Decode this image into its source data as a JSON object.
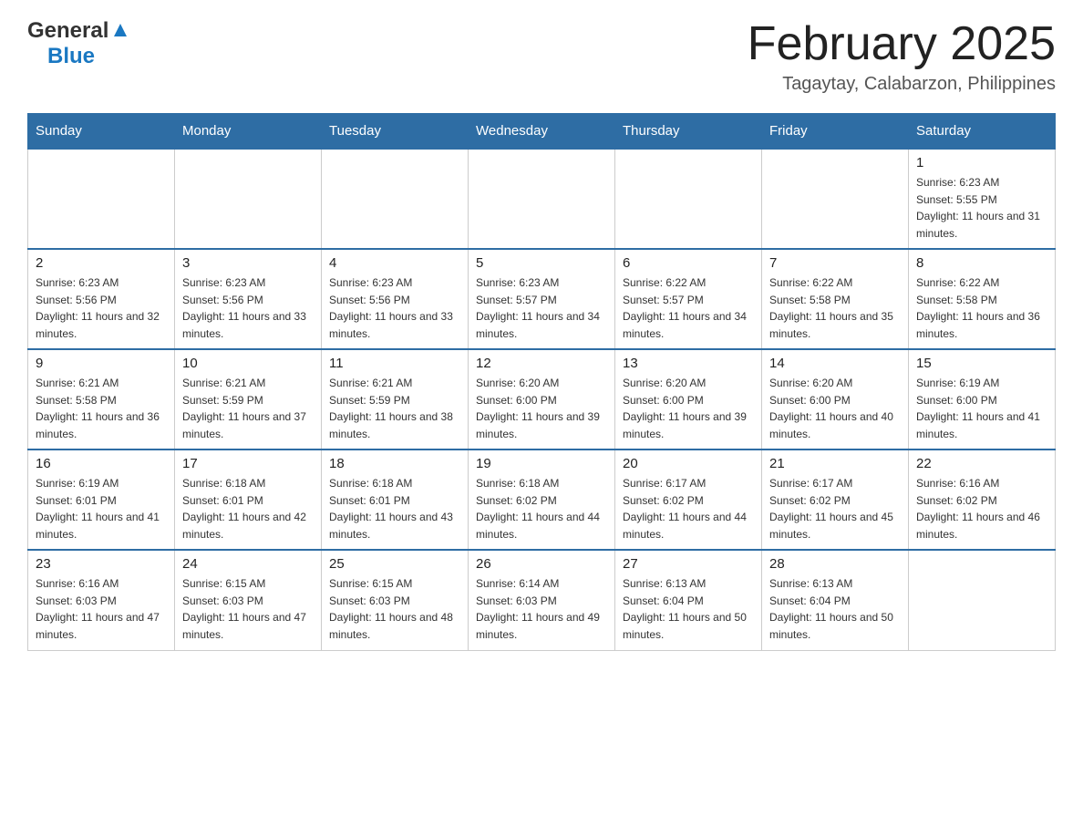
{
  "header": {
    "logo_general": "General",
    "logo_blue": "Blue",
    "month_title": "February 2025",
    "location": "Tagaytay, Calabarzon, Philippines"
  },
  "days_of_week": [
    "Sunday",
    "Monday",
    "Tuesday",
    "Wednesday",
    "Thursday",
    "Friday",
    "Saturday"
  ],
  "weeks": [
    [
      {
        "day": "",
        "info": ""
      },
      {
        "day": "",
        "info": ""
      },
      {
        "day": "",
        "info": ""
      },
      {
        "day": "",
        "info": ""
      },
      {
        "day": "",
        "info": ""
      },
      {
        "day": "",
        "info": ""
      },
      {
        "day": "1",
        "info": "Sunrise: 6:23 AM\nSunset: 5:55 PM\nDaylight: 11 hours and 31 minutes."
      }
    ],
    [
      {
        "day": "2",
        "info": "Sunrise: 6:23 AM\nSunset: 5:56 PM\nDaylight: 11 hours and 32 minutes."
      },
      {
        "day": "3",
        "info": "Sunrise: 6:23 AM\nSunset: 5:56 PM\nDaylight: 11 hours and 33 minutes."
      },
      {
        "day": "4",
        "info": "Sunrise: 6:23 AM\nSunset: 5:56 PM\nDaylight: 11 hours and 33 minutes."
      },
      {
        "day": "5",
        "info": "Sunrise: 6:23 AM\nSunset: 5:57 PM\nDaylight: 11 hours and 34 minutes."
      },
      {
        "day": "6",
        "info": "Sunrise: 6:22 AM\nSunset: 5:57 PM\nDaylight: 11 hours and 34 minutes."
      },
      {
        "day": "7",
        "info": "Sunrise: 6:22 AM\nSunset: 5:58 PM\nDaylight: 11 hours and 35 minutes."
      },
      {
        "day": "8",
        "info": "Sunrise: 6:22 AM\nSunset: 5:58 PM\nDaylight: 11 hours and 36 minutes."
      }
    ],
    [
      {
        "day": "9",
        "info": "Sunrise: 6:21 AM\nSunset: 5:58 PM\nDaylight: 11 hours and 36 minutes."
      },
      {
        "day": "10",
        "info": "Sunrise: 6:21 AM\nSunset: 5:59 PM\nDaylight: 11 hours and 37 minutes."
      },
      {
        "day": "11",
        "info": "Sunrise: 6:21 AM\nSunset: 5:59 PM\nDaylight: 11 hours and 38 minutes."
      },
      {
        "day": "12",
        "info": "Sunrise: 6:20 AM\nSunset: 6:00 PM\nDaylight: 11 hours and 39 minutes."
      },
      {
        "day": "13",
        "info": "Sunrise: 6:20 AM\nSunset: 6:00 PM\nDaylight: 11 hours and 39 minutes."
      },
      {
        "day": "14",
        "info": "Sunrise: 6:20 AM\nSunset: 6:00 PM\nDaylight: 11 hours and 40 minutes."
      },
      {
        "day": "15",
        "info": "Sunrise: 6:19 AM\nSunset: 6:00 PM\nDaylight: 11 hours and 41 minutes."
      }
    ],
    [
      {
        "day": "16",
        "info": "Sunrise: 6:19 AM\nSunset: 6:01 PM\nDaylight: 11 hours and 41 minutes."
      },
      {
        "day": "17",
        "info": "Sunrise: 6:18 AM\nSunset: 6:01 PM\nDaylight: 11 hours and 42 minutes."
      },
      {
        "day": "18",
        "info": "Sunrise: 6:18 AM\nSunset: 6:01 PM\nDaylight: 11 hours and 43 minutes."
      },
      {
        "day": "19",
        "info": "Sunrise: 6:18 AM\nSunset: 6:02 PM\nDaylight: 11 hours and 44 minutes."
      },
      {
        "day": "20",
        "info": "Sunrise: 6:17 AM\nSunset: 6:02 PM\nDaylight: 11 hours and 44 minutes."
      },
      {
        "day": "21",
        "info": "Sunrise: 6:17 AM\nSunset: 6:02 PM\nDaylight: 11 hours and 45 minutes."
      },
      {
        "day": "22",
        "info": "Sunrise: 6:16 AM\nSunset: 6:02 PM\nDaylight: 11 hours and 46 minutes."
      }
    ],
    [
      {
        "day": "23",
        "info": "Sunrise: 6:16 AM\nSunset: 6:03 PM\nDaylight: 11 hours and 47 minutes."
      },
      {
        "day": "24",
        "info": "Sunrise: 6:15 AM\nSunset: 6:03 PM\nDaylight: 11 hours and 47 minutes."
      },
      {
        "day": "25",
        "info": "Sunrise: 6:15 AM\nSunset: 6:03 PM\nDaylight: 11 hours and 48 minutes."
      },
      {
        "day": "26",
        "info": "Sunrise: 6:14 AM\nSunset: 6:03 PM\nDaylight: 11 hours and 49 minutes."
      },
      {
        "day": "27",
        "info": "Sunrise: 6:13 AM\nSunset: 6:04 PM\nDaylight: 11 hours and 50 minutes."
      },
      {
        "day": "28",
        "info": "Sunrise: 6:13 AM\nSunset: 6:04 PM\nDaylight: 11 hours and 50 minutes."
      },
      {
        "day": "",
        "info": ""
      }
    ]
  ]
}
